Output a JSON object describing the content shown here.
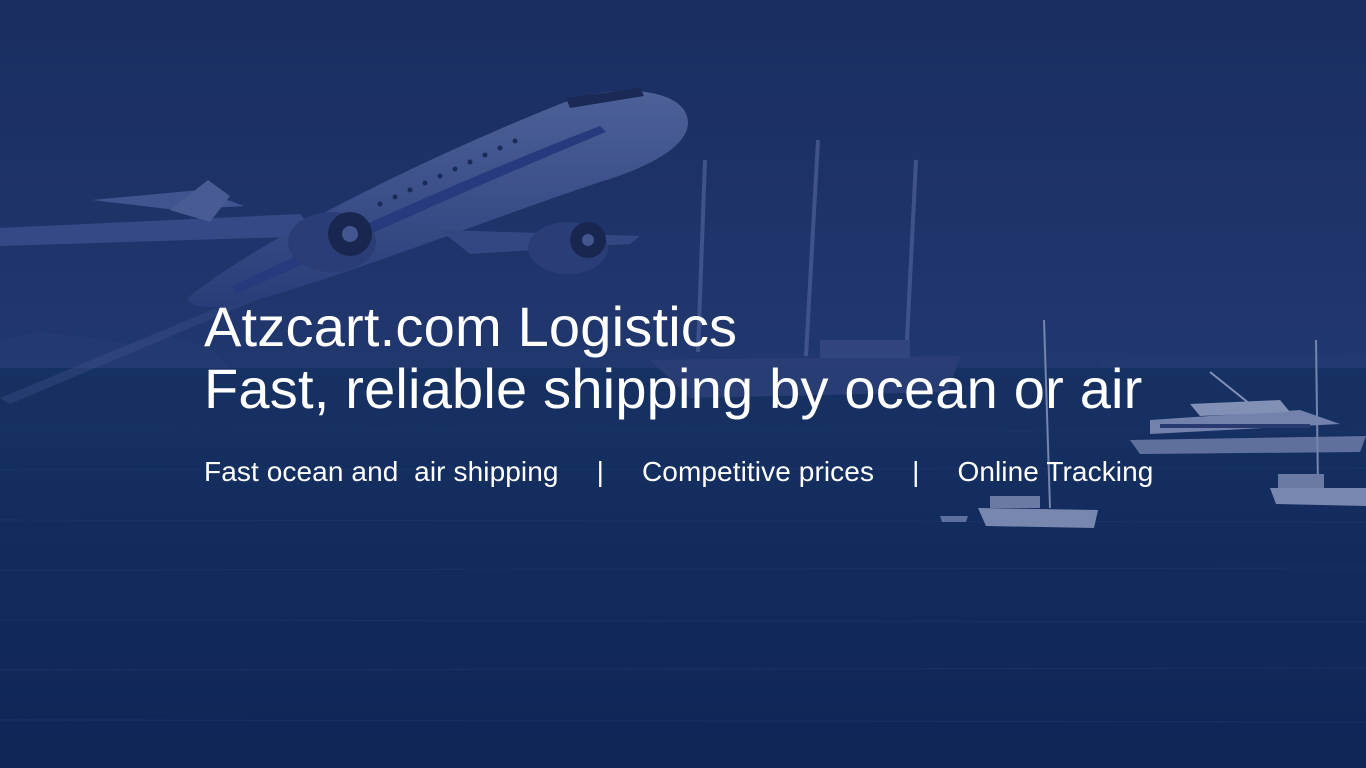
{
  "hero": {
    "title_line1": "Atzcart.com Logistics",
    "title_line2": "Fast, reliable shipping by ocean or air",
    "features": [
      "Fast ocean and  air shipping",
      "Competitive prices",
      "Online Tracking"
    ],
    "separator": "|"
  },
  "background": {
    "sky_color": "#1e3468",
    "sea_color": "#0f2a5e",
    "icons": [
      "airplane-icon",
      "sailing-yacht-icon",
      "motor-yacht-icon",
      "sailboat-icon"
    ]
  }
}
